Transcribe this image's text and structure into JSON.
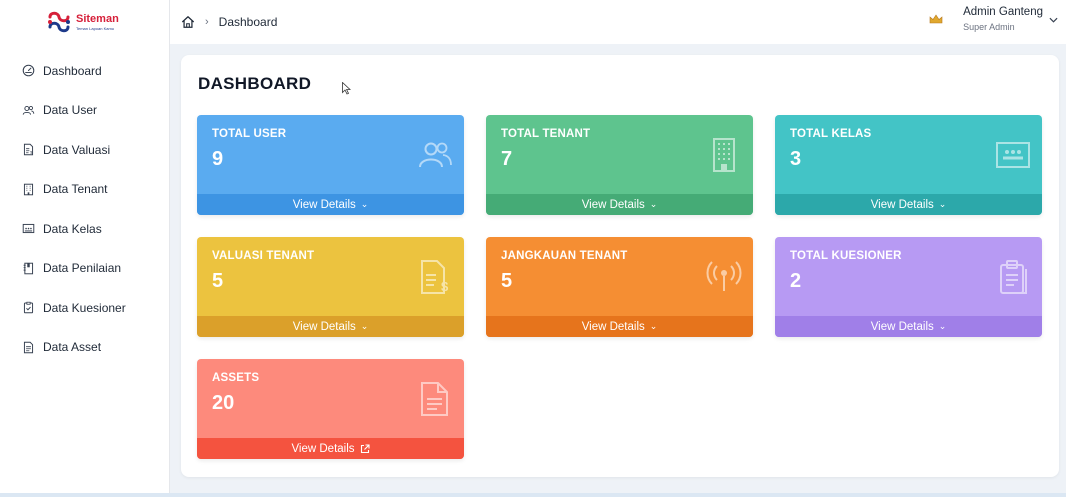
{
  "brand": {
    "name": "Siteman",
    "tagline": "Teman Lapoan Kamu",
    "logo_colors": [
      "#d6203a",
      "#1e3a8a"
    ]
  },
  "sidebar": {
    "items": [
      {
        "label": "Dashboard",
        "icon": "gauge-icon"
      },
      {
        "label": "Data User",
        "icon": "users-icon"
      },
      {
        "label": "Data Valuasi",
        "icon": "invoice-icon"
      },
      {
        "label": "Data Tenant",
        "icon": "building-icon"
      },
      {
        "label": "Data Kelas",
        "icon": "classroom-icon"
      },
      {
        "label": "Data Penilaian",
        "icon": "journal-icon"
      },
      {
        "label": "Data Kuesioner",
        "icon": "clipboard-check-icon"
      },
      {
        "label": "Data Asset",
        "icon": "document-icon"
      }
    ]
  },
  "header": {
    "breadcrumb": {
      "home_icon": "home-icon",
      "current": "Dashboard"
    },
    "user": {
      "name": "Admin Ganteng",
      "role": "Super Admin",
      "icon": "crown-icon"
    }
  },
  "main": {
    "title": "DASHBOARD",
    "cards": [
      {
        "title": "TOTAL USER",
        "value": "9",
        "footer": "View Details",
        "icon": "users-icon",
        "color": "#5aabf0",
        "footer_color": "#3d94e3"
      },
      {
        "title": "TOTAL TENANT",
        "value": "7",
        "footer": "View Details",
        "icon": "building-icon",
        "color": "#5ec48e",
        "footer_color": "#45ab76"
      },
      {
        "title": "TOTAL KELAS",
        "value": "3",
        "footer": "View Details",
        "icon": "classroom-icon",
        "color": "#43c4c6",
        "footer_color": "#2ca8aa"
      },
      {
        "title": "VALUASI TENANT",
        "value": "5",
        "footer": "View Details",
        "icon": "invoice-dollar-icon",
        "color": "#ecc33f",
        "footer_color": "#dba02a"
      },
      {
        "title": "JANGKAUAN TENANT",
        "value": "5",
        "footer": "View Details",
        "icon": "broadcast-icon",
        "color": "#f58e33",
        "footer_color": "#e6741c"
      },
      {
        "title": "TOTAL KUESIONER",
        "value": "2",
        "footer": "View Details",
        "icon": "clipboard-icon",
        "color": "#b79af3",
        "footer_color": "#a07fe8"
      },
      {
        "title": "ASSETS",
        "value": "20",
        "footer": "View Details",
        "icon": "document-icon",
        "color": "#fd8a7c",
        "footer_color": "#f4533f"
      }
    ]
  }
}
